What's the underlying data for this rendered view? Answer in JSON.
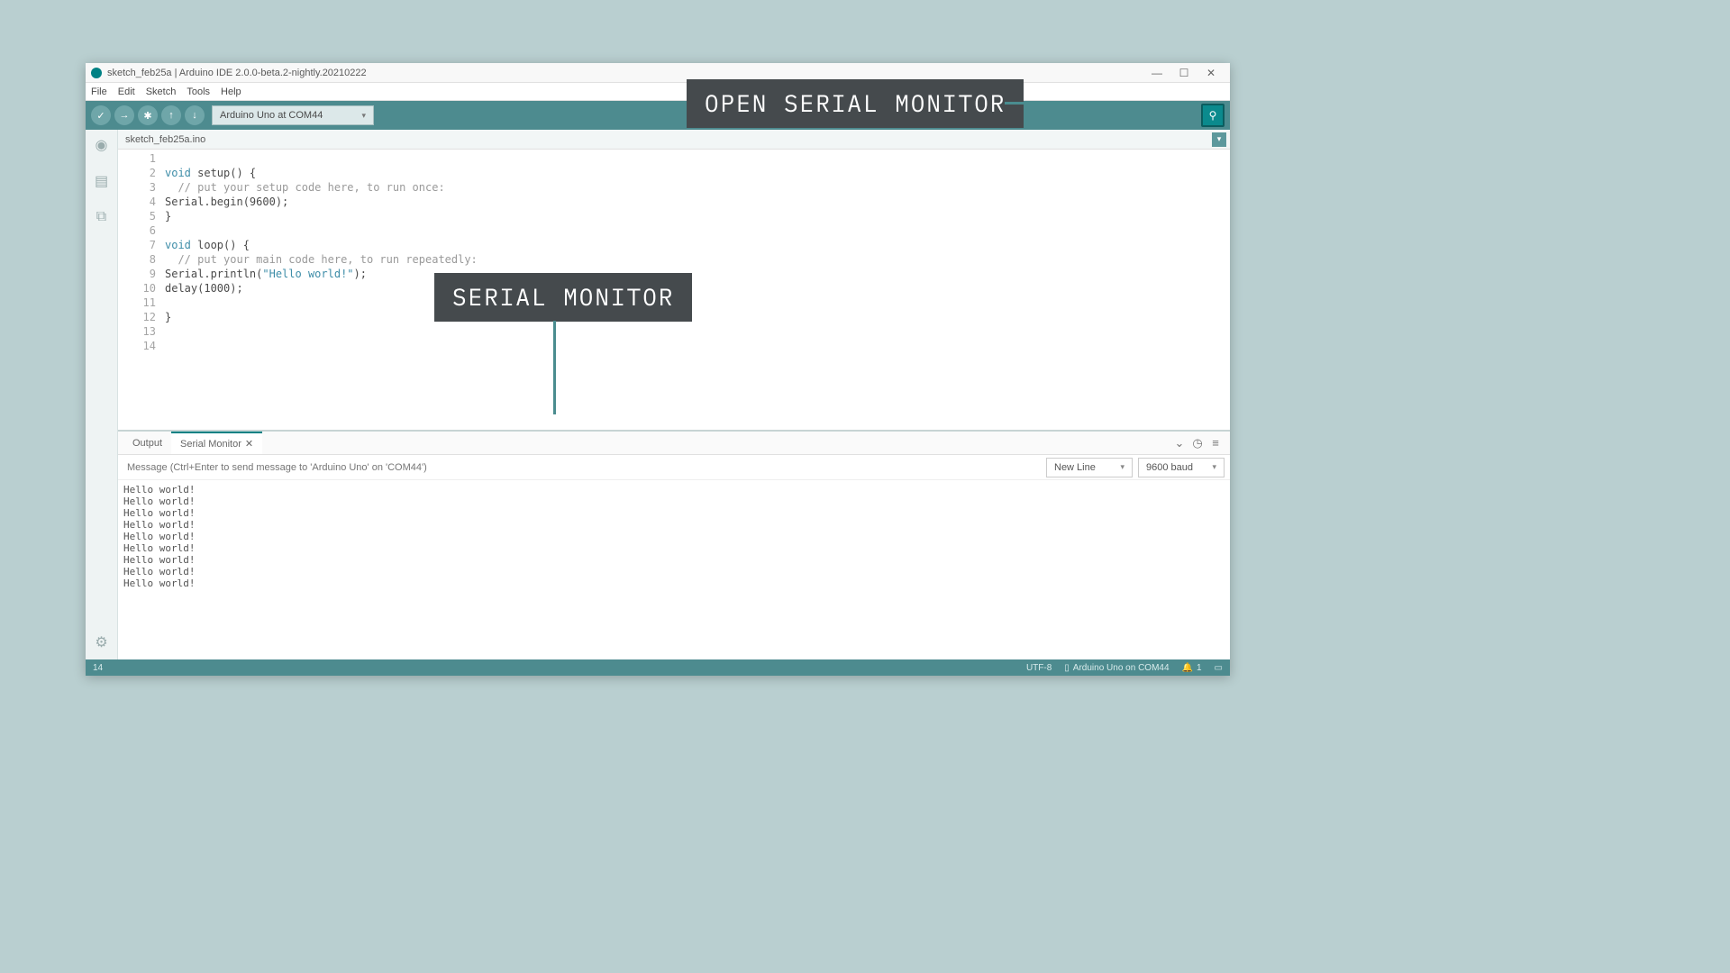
{
  "titlebar": {
    "title": "sketch_feb25a | Arduino IDE 2.0.0-beta.2-nightly.20210222"
  },
  "menu": {
    "items": [
      "File",
      "Edit",
      "Sketch",
      "Tools",
      "Help"
    ]
  },
  "toolbar": {
    "verify_symbol": "✓",
    "upload_symbol": "→",
    "debug_symbol": "✱",
    "arrow_up_symbol": "↑",
    "arrow_down_symbol": "↓",
    "board_label": "Arduino Uno at COM44",
    "serial_monitor_symbol": "⚲"
  },
  "editor": {
    "tab_name": "sketch_feb25a.ino",
    "lines_numbers": [
      "1",
      "2",
      "3",
      "4",
      "5",
      "6",
      "7",
      "8",
      "9",
      "10",
      "11",
      "12",
      "13",
      "14"
    ],
    "code_lines": [
      {
        "html": "&nbsp;"
      },
      {
        "html": "<span class=\"kw\">void</span> setup() {"
      },
      {
        "html": "  <span class=\"cm\">// put your setup code here, to run once:</span>"
      },
      {
        "html": "Serial.begin(9600);"
      },
      {
        "html": "}"
      },
      {
        "html": "&nbsp;"
      },
      {
        "html": "<span class=\"kw\">void</span> loop() {"
      },
      {
        "html": "  <span class=\"cm\">// put your main code here, to run repeatedly:</span>"
      },
      {
        "html": "Serial.println(<span class=\"str\">\"Hello world!\"</span>);"
      },
      {
        "html": "delay(1000);"
      },
      {
        "html": "&nbsp;"
      },
      {
        "html": "}"
      },
      {
        "html": "&nbsp;"
      },
      {
        "html": "&nbsp;"
      }
    ],
    "highlight_line_index": 13
  },
  "bottom": {
    "tabs": {
      "output": "Output",
      "serial": "Serial Monitor"
    },
    "input_placeholder": "Message (Ctrl+Enter to send message to 'Arduino Uno' on 'COM44')",
    "line_ending": "New Line",
    "baud_rate": "9600 baud",
    "icons": {
      "expand": "⌄",
      "clock": "◷",
      "clear": "≡"
    },
    "output_lines": [
      "Hello world!",
      "Hello world!",
      "Hello world!",
      "Hello world!",
      "Hello world!",
      "Hello world!",
      "Hello world!",
      "Hello world!",
      "Hello world!"
    ]
  },
  "statusbar": {
    "line": "14",
    "encoding": "UTF-8",
    "board": "Arduino Uno on COM44",
    "notifications": "1"
  },
  "annotations": {
    "open_serial": "OPEN SERIAL MONITOR",
    "serial_monitor": "SERIAL MONITOR"
  }
}
